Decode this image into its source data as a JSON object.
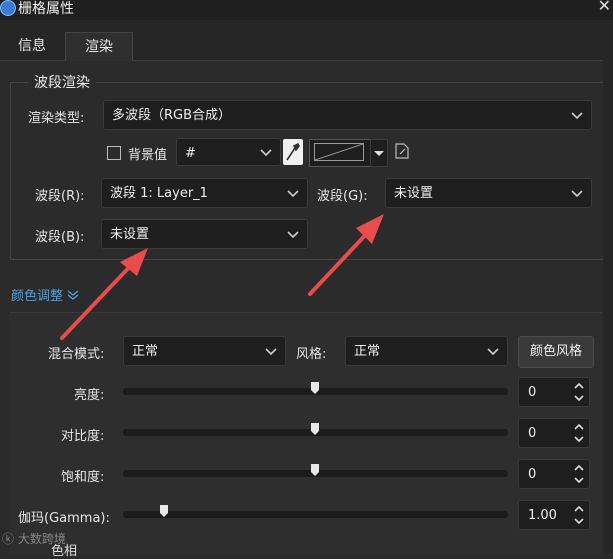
{
  "window": {
    "title": "栅格属性"
  },
  "tabs": [
    {
      "label": "信息"
    },
    {
      "label": "渲染"
    }
  ],
  "band_render": {
    "group_title": "波段渲染",
    "render_type_label": "渲染类型:",
    "render_type_value": "多波段（RGB合成）",
    "background_label": "背景值",
    "background_value": "#",
    "band_r_label": "波段(R):",
    "band_r_value": "波段 1: Layer_1",
    "band_g_label": "波段(G):",
    "band_g_value": "未设置",
    "band_b_label": "波段(B):",
    "band_b_value": "未设置"
  },
  "color_adjust": {
    "link_label": "颜色调整",
    "blend_label": "混合模式:",
    "blend_value": "正常",
    "style_label": "风格:",
    "style_value": "正常",
    "color_style_button": "颜色风格",
    "brightness_label": "亮度:",
    "brightness_value": "0",
    "contrast_label": "对比度:",
    "contrast_value": "0",
    "saturation_label": "饱和度:",
    "saturation_value": "0",
    "gamma_label": "伽玛(Gamma):",
    "gamma_value": "1.00",
    "hue_label_partial": "色相"
  },
  "watermark": {
    "text": "大数跨境"
  },
  "colors": {
    "accent_link": "#4aa3df",
    "arrow": "#e84c4c",
    "bg": "#2b2b2b",
    "field_bg": "#1e1e1e"
  }
}
